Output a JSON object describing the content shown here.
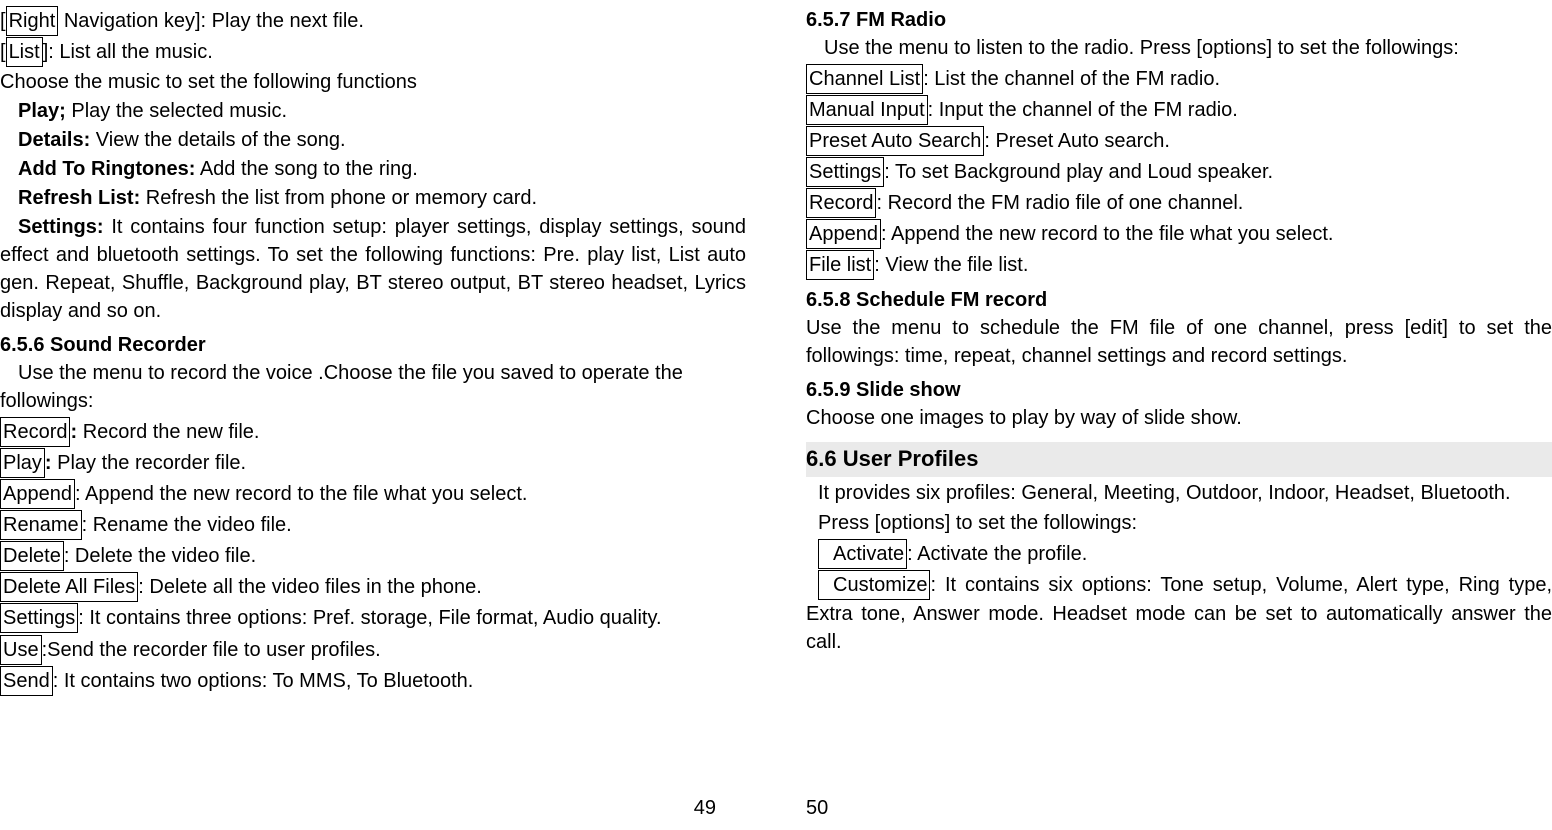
{
  "left": {
    "l1_prefix": "[",
    "l1_box": "Right",
    "l1_rest": " Navigation key]: Play the next file.",
    "l2_prefix": "[",
    "l2_box": "List",
    "l2_rest": "]: List all the music.",
    "l3": "Choose the music to set the following functions",
    "l4_b": "Play;",
    "l4_r": " Play the selected music.",
    "l5_b": "Details:",
    "l5_r": " View the details of the song.",
    "l6_b": "Add To Ringtones:",
    "l6_r": " Add the song to the ring.",
    "l7_b": "Refresh List:",
    "l7_r": " Refresh the list from phone or memory card.",
    "l8_b": "Settings:",
    "l8_r": " It contains four function setup: player settings, display settings, sound effect and bluetooth settings. To set the following functions: Pre. play list, List auto gen. Repeat, Shuffle, Background play, BT stereo output, BT stereo headset, Lyrics display and so on.",
    "h656": "6.5.6 Sound Recorder",
    "p656": "Use the menu to record the voice .Choose the file you saved to operate the followings:",
    "sr1_box": "Record",
    "sr1_b": ":",
    "sr1_r": " Record the new file.",
    "sr2_box": "Play",
    "sr2_b": ":",
    "sr2_r": " Play the recorder file.",
    "sr3_box": "Append",
    "sr3_r": ": Append the new record to the file what you select.",
    "sr4_box": "Rename",
    "sr4_r": ": Rename the video file.",
    "sr5_box": "Delete",
    "sr5_r": ": Delete the video file.",
    "sr6_box": "Delete All Files",
    "sr6_r": ": Delete all the video files in the phone.",
    "sr7_box": "Settings",
    "sr7_r": ": It contains three options: Pref. storage, File format, Audio quality.",
    "sr8_box": "Use",
    "sr8_r": ":Send the recorder file to user profiles.",
    "sr9_box": "Send",
    "sr9_r": ": It contains two options: To MMS, To Bluetooth.",
    "pagenum": "49"
  },
  "right": {
    "h657": "6.5.7 FM Radio",
    "p657": "Use the menu to listen to the radio. Press [options] to set the followings:",
    "fm1_box": "Channel List",
    "fm1_r": ": List the channel of the FM radio.",
    "fm2_box": "Manual Input",
    "fm2_r": ": Input the channel of the FM radio.",
    "fm3_box": "Preset Auto Search",
    "fm3_r": ": Preset Auto search.",
    "fm4_box": "Settings",
    "fm4_r": ": To set Background play and Loud speaker.",
    "fm5_box": "Record",
    "fm5_r": ": Record the FM radio file of one channel.",
    "fm6_box": "Append",
    "fm6_r": ": Append the new record to the file what you select.",
    "fm7_box": "File list",
    "fm7_r": ": View the file list.",
    "h658": "6.5.8 Schedule FM record",
    "p658": "Use the menu to schedule the FM file of one channel, press [edit] to set the followings: time, repeat, channel settings and record settings.",
    "h659": "6.5.9 Slide show",
    "p659": "Choose one images to play by way of slide show.",
    "h66": "6.6 User Profiles",
    "p66a": "It provides six profiles: General, Meeting, Outdoor, Indoor, Headset, Bluetooth.",
    "p66b": "Press [options] to set the followings:",
    "up1_box": "Activate",
    "up1_r": ": Activate the profile.",
    "up2_box": "Customize",
    "up2_r": ": It contains six options: Tone setup, Volume, Alert type, Ring type, Extra tone, Answer mode. Headset mode can be set to automatically answer the call.",
    "pagenum": "50"
  }
}
